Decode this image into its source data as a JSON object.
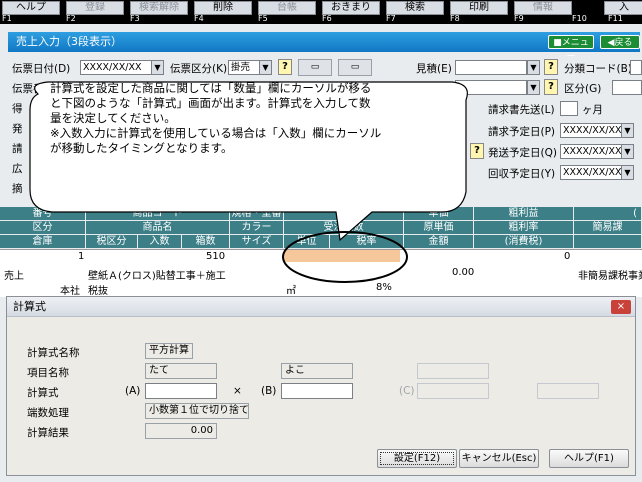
{
  "fkeys": [
    {
      "label": "ヘルプ",
      "num": "F1",
      "disabled": false
    },
    {
      "label": "登録",
      "num": "F2",
      "disabled": true
    },
    {
      "label": "検索解除",
      "num": "F3",
      "disabled": true
    },
    {
      "label": "削除",
      "num": "F4",
      "disabled": false
    },
    {
      "label": "台帳",
      "num": "F5",
      "disabled": true
    },
    {
      "label": "おきまり",
      "num": "F6",
      "disabled": false
    },
    {
      "label": "検索",
      "num": "F7",
      "disabled": false
    },
    {
      "label": "印刷",
      "num": "F8",
      "disabled": false
    },
    {
      "label": "情報",
      "num": "F9",
      "disabled": true
    },
    {
      "label": "入",
      "num": "F11",
      "disabled": false
    }
  ],
  "fnum_extra": "F10",
  "title": "売上入力（3段表示）",
  "menu_button": "メニュー",
  "back_button": "戻る",
  "form": {
    "denpyo_date_label": "伝票日付(D)",
    "denpyo_date_value": "XXXX/XX/XX",
    "denpyo_kubun_label": "伝票区分(K)",
    "denpyo_kubun_value": "掛売",
    "mitsumori_label": "見積(E)",
    "bunrui_label": "分類コード(B)",
    "kubun_label": "区分(G)",
    "denpyo_bango_label": "伝票番号",
    "seikyusho_label": "請求書先送(L)",
    "seikyusho_unit": "ヶ月",
    "seikyu_yotei_label": "請求予定日(P)",
    "seikyu_yotei_value": "XXXX/XX/XX",
    "hasso_yotei_label": "発送予定日(Q)",
    "hasso_yotei_value": "XXXX/XX/XX",
    "kaishu_yotei_label": "回収予定日(Y)",
    "kaishu_yotei_value": "XXXX/XX/XX",
    "cut_labels": [
      "得",
      "発",
      "請",
      "広",
      "摘"
    ]
  },
  "callout": {
    "lines": [
      "計算式を設定した商品に関しては「数量」欄にカーソルが移る",
      "と下図のような「計算式」画面が出ます。計算式を入力して数",
      "量を決定してください。",
      "※入数入力に計算式を使用している場合は「入数」欄にカーソル",
      "が移動したタイミングとなります。"
    ]
  },
  "grid": {
    "header_row1": [
      "番号",
      "商品コード",
      "規格・型番",
      "単価",
      "粗利益"
    ],
    "header_row2": [
      "区分",
      "商品名",
      "カラー",
      "原単価",
      "粗利率",
      "簡易課"
    ],
    "header_row3": [
      "倉庫",
      "税区分",
      "入数",
      "箱数",
      "サイズ",
      "単位",
      "税率",
      "金額",
      "(消費税)"
    ],
    "header_hidden": "受注残数",
    "header_cut": "(",
    "row1": {
      "num": "1",
      "code": "510",
      "tanka": "0"
    },
    "row2": {
      "kubun": "売上",
      "name": "壁紙Ａ(クロス)貼替工事＋施工",
      "kingaku": "0.00",
      "kani": "非簡易課税事業"
    },
    "row3": {
      "soko": "本社",
      "zei": "税抜",
      "tani": "㎡",
      "zeiritsu": "8%"
    }
  },
  "dialog": {
    "title": "計算式",
    "formula_name_label": "計算式名称",
    "formula_name_value": "平方計算",
    "item_name_label": "項目名称",
    "item_a": "たて",
    "item_b": "よこ",
    "formula_label": "計算式",
    "a_label": "(A)",
    "times": "×",
    "b_label": "(B)",
    "c_label": "(C)",
    "rounding_label": "端数処理",
    "rounding_value": "小数第１位で切り捨て",
    "result_label": "計算結果",
    "result_value": "0.00",
    "btn_ok": "設定(F12)",
    "btn_cancel": "キャンセル(Esc)",
    "btn_help": "ヘルプ(F1)",
    "close": "×"
  }
}
